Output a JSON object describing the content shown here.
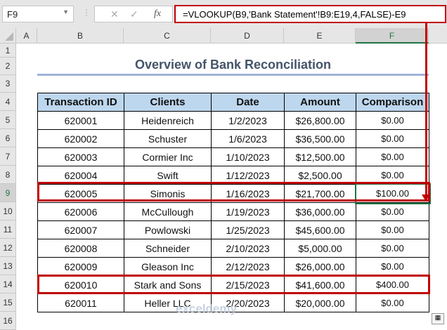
{
  "name_box": "F9",
  "formula": "=VLOOKUP(B9,'Bank Statement'!B9:E19,4,FALSE)-E9",
  "columns": [
    "A",
    "B",
    "C",
    "D",
    "E",
    "F"
  ],
  "rows": [
    "1",
    "2",
    "3",
    "4",
    "5",
    "6",
    "7",
    "8",
    "9",
    "10",
    "11",
    "12",
    "13",
    "14",
    "15",
    "16"
  ],
  "title": "Overview of Bank Reconciliation",
  "headers": [
    "Transaction ID",
    "Clients",
    "Date",
    "Amount",
    "Comparison"
  ],
  "data": [
    [
      "620001",
      "Heidenreich",
      "1/2/2023",
      "$26,800.00",
      "$0.00"
    ],
    [
      "620002",
      "Schuster",
      "1/6/2023",
      "$36,500.00",
      "$0.00"
    ],
    [
      "620003",
      "Cormier Inc",
      "1/10/2023",
      "$12,500.00",
      "$0.00"
    ],
    [
      "620004",
      "Swift",
      "1/12/2023",
      "$2,500.00",
      "$0.00"
    ],
    [
      "620005",
      "Simonis",
      "1/16/2023",
      "$21,700.00",
      "$100.00"
    ],
    [
      "620006",
      "McCullough",
      "1/19/2023",
      "$36,000.00",
      "$0.00"
    ],
    [
      "620007",
      "Powlowski",
      "1/25/2023",
      "$45,600.00",
      "$0.00"
    ],
    [
      "620008",
      "Schneider",
      "2/10/2023",
      "$5,000.00",
      "$0.00"
    ],
    [
      "620009",
      "Gleason Inc",
      "2/12/2023",
      "$26,000.00",
      "$0.00"
    ],
    [
      "620010",
      "Stark and Sons",
      "2/15/2023",
      "$41,600.00",
      "$400.00"
    ],
    [
      "620011",
      "Heller LLC",
      "2/20/2023",
      "$20,000.00",
      "$0.00"
    ]
  ],
  "watermark": "exceldemy",
  "colors": {
    "highlight": "#c00000",
    "header_fill": "#bdd7ee",
    "title": "#44546a"
  }
}
